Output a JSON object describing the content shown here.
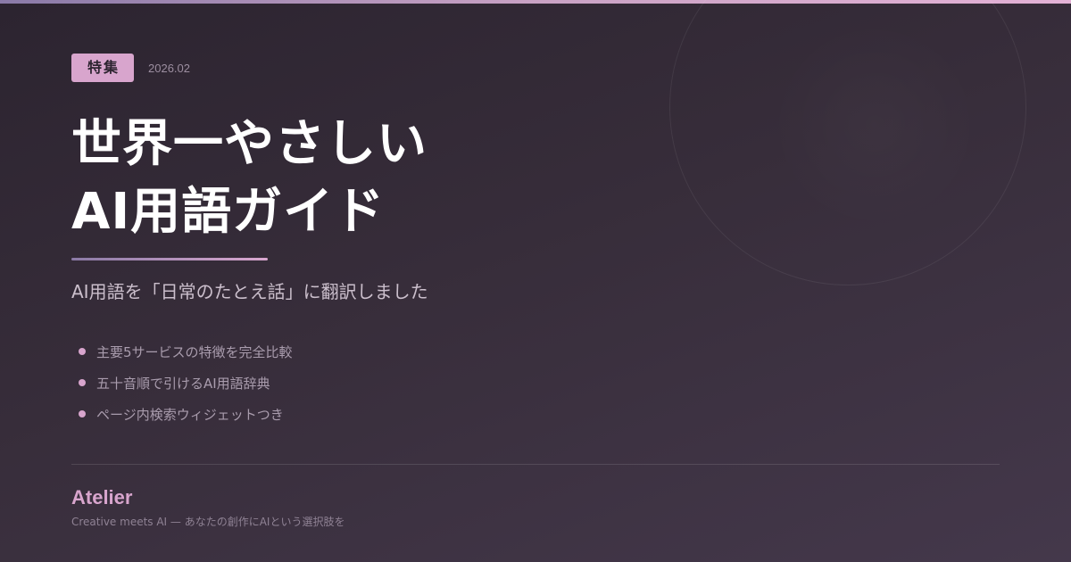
{
  "colors": {
    "accent": "#d8a5cd",
    "background_start": "#2c2430",
    "background_end": "#44384b",
    "title": "#ffffff"
  },
  "header": {
    "tag": "特集",
    "date": "2026.02"
  },
  "title": {
    "line1": "世界一やさしい",
    "line2": "AI用語ガイド"
  },
  "subtitle": "AI用語を「日常のたとえ話」に翻訳しました",
  "features": [
    "主要5サービスの特徴を完全比較",
    "五十音順で引けるAI用語辞典",
    "ページ内検索ウィジェットつき"
  ],
  "footer": {
    "brand": "Atelier",
    "tagline": "Creative meets AI — あなたの創作にAIという選択肢を"
  }
}
